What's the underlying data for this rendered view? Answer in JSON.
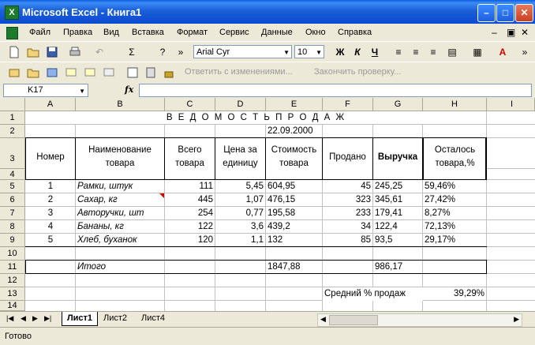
{
  "window": {
    "title": "Microsoft Excel - Книга1",
    "app_icon": "excel-icon"
  },
  "menu": [
    "Файл",
    "Правка",
    "Вид",
    "Вставка",
    "Формат",
    "Сервис",
    "Данные",
    "Окно",
    "Справка"
  ],
  "toolbar": {
    "font_name": "Arial Cyr",
    "font_size": "10",
    "bold_label": "Ж",
    "italic_label": "К",
    "underline_label": "Ч",
    "reply_changes": "Ответить с изменениями...",
    "end_review": "Закончить проверку..."
  },
  "formula_bar": {
    "name_box": "K17",
    "fx": "fx",
    "formula": ""
  },
  "columns": [
    "A",
    "B",
    "C",
    "D",
    "E",
    "F",
    "G",
    "H",
    "I"
  ],
  "rows": [
    "1",
    "2",
    "3",
    "4",
    "5",
    "6",
    "7",
    "8",
    "9",
    "10",
    "11",
    "12",
    "13",
    "14"
  ],
  "sheet": {
    "title": "В Е Д О М О С Т Ь   П Р О Д А Ж",
    "date": "22.09.2000",
    "headers": {
      "num": "Номер",
      "name_l1": "Наименование",
      "name_l2": "товара",
      "total_l1": "Всего",
      "total_l2": "товара",
      "price_l1": "Цена за",
      "price_l2": "единицу",
      "cost_l1": "Стоимость",
      "cost_l2": "товара",
      "sold": "Продано",
      "revenue": "Выручка",
      "left_l1": "Осталось",
      "left_l2": "товара,%"
    },
    "items": [
      {
        "num": "1",
        "name": "Рамки, штук",
        "total": "111",
        "price": "5,45",
        "cost": "604,95",
        "sold": "45",
        "revenue": "245,25",
        "left": "59,46%"
      },
      {
        "num": "2",
        "name": "Сахар, кг",
        "total": "445",
        "price": "1,07",
        "cost": "476,15",
        "sold": "323",
        "revenue": "345,61",
        "left": "27,42%"
      },
      {
        "num": "3",
        "name": "Авторучки, шт",
        "total": "254",
        "price": "0,77",
        "cost": "195,58",
        "sold": "233",
        "revenue": "179,41",
        "left": "8,27%"
      },
      {
        "num": "4",
        "name": "Бананы, кг",
        "total": "122",
        "price": "3,6",
        "cost": "439,2",
        "sold": "34",
        "revenue": "122,4",
        "left": "72,13%"
      },
      {
        "num": "5",
        "name": "Хлеб, буханок",
        "total": "120",
        "price": "1,1",
        "cost": "132",
        "sold": "85",
        "revenue": "93,5",
        "left": "29,17%"
      }
    ],
    "total_label": "Итого",
    "total_cost": "1847,88",
    "total_revenue": "986,17",
    "avg_label": "Средний % продаж",
    "avg_value": "39,29%"
  },
  "tabs": [
    "Лист1",
    "Лист2",
    "Лист4"
  ],
  "status": "Готово",
  "colors": {
    "titlebar": "#0b4ad0",
    "close": "#c7401f",
    "comment_marker": "#cc0000"
  }
}
